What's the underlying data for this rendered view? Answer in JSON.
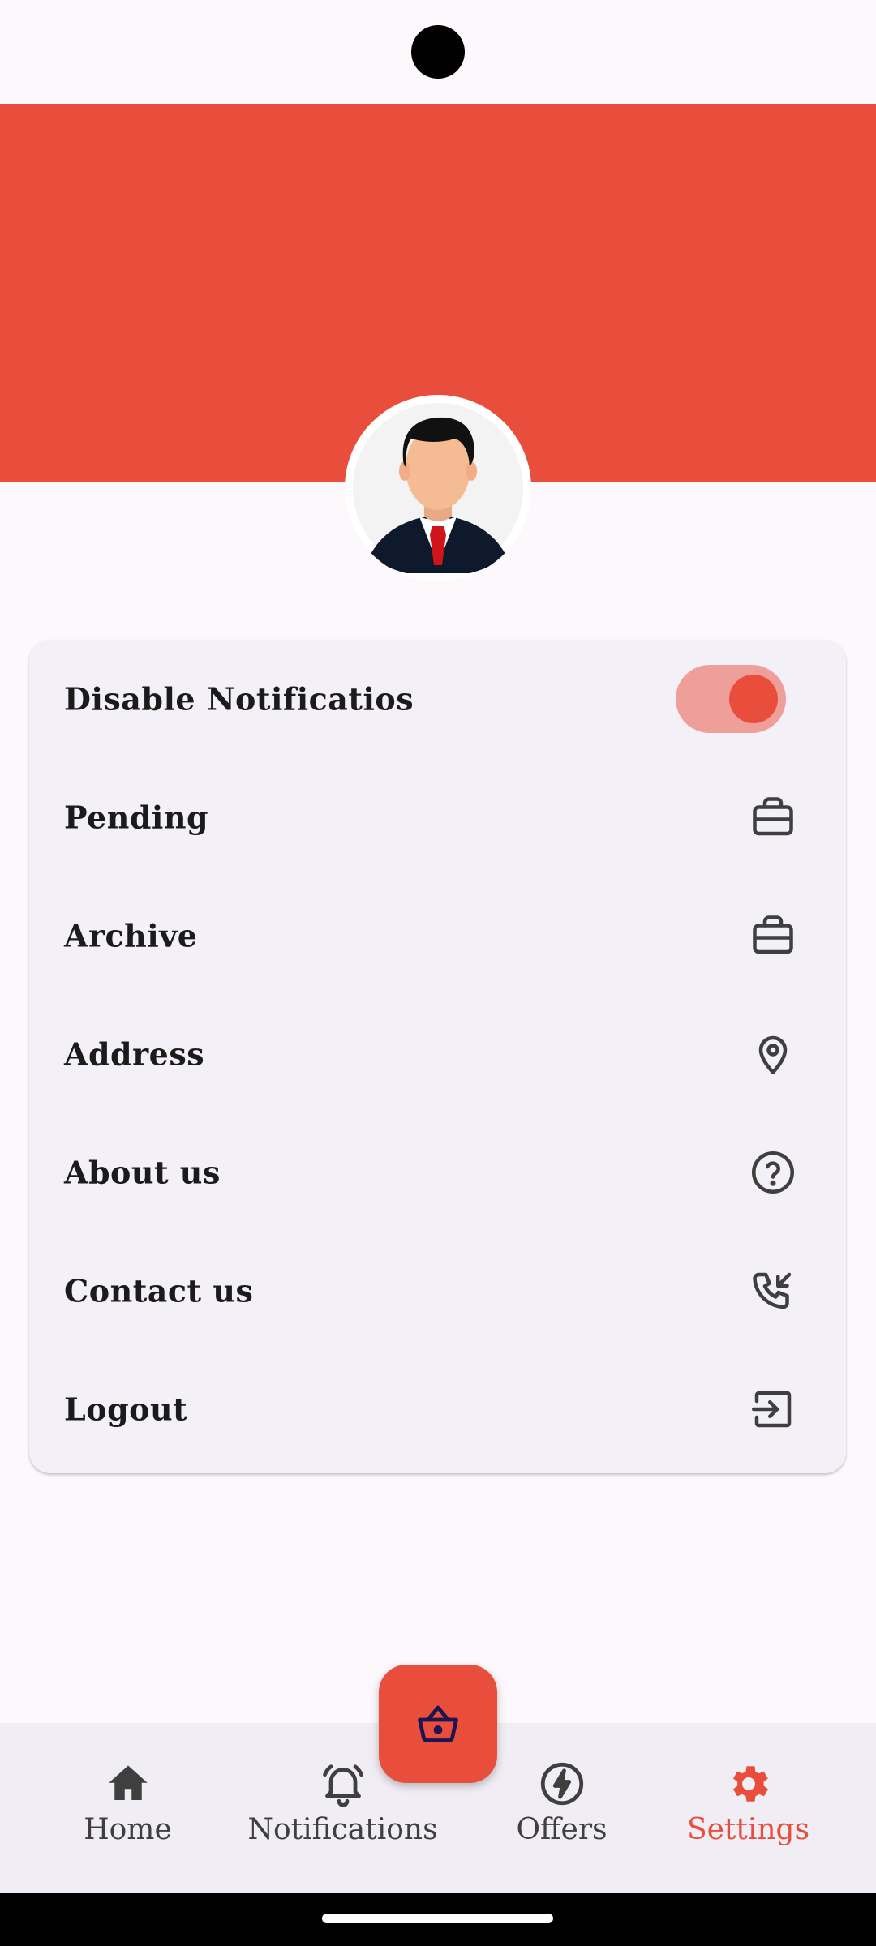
{
  "colors": {
    "accent": "#e94e3d",
    "toggle_track": "#ef9f9a",
    "card_bg": "#f4f0f7",
    "nav_bg": "#f1edf4",
    "text_dark": "#1b1b1b",
    "icon_gray": "#3f3f3f"
  },
  "profile": {
    "avatar_icon": "businessman-avatar"
  },
  "menu": {
    "items": [
      {
        "label": "Disable Notificatios",
        "control": "toggle",
        "toggle_on": true
      },
      {
        "label": "Pending",
        "icon": "briefcase-icon"
      },
      {
        "label": "Archive",
        "icon": "briefcase-icon"
      },
      {
        "label": "Address",
        "icon": "location-pin-icon"
      },
      {
        "label": "About us",
        "icon": "help-circle-icon"
      },
      {
        "label": "Contact us",
        "icon": "phone-incoming-icon"
      },
      {
        "label": "Logout",
        "icon": "logout-icon"
      }
    ]
  },
  "fab": {
    "icon": "basket-icon"
  },
  "nav": {
    "items": [
      {
        "label": "Home",
        "icon": "home-icon",
        "active": false
      },
      {
        "label": "Notifications",
        "icon": "bell-icon",
        "active": false
      },
      {
        "label": "Offers",
        "icon": "lightning-icon",
        "active": false
      },
      {
        "label": "Settings",
        "icon": "gear-icon",
        "active": true
      }
    ]
  }
}
